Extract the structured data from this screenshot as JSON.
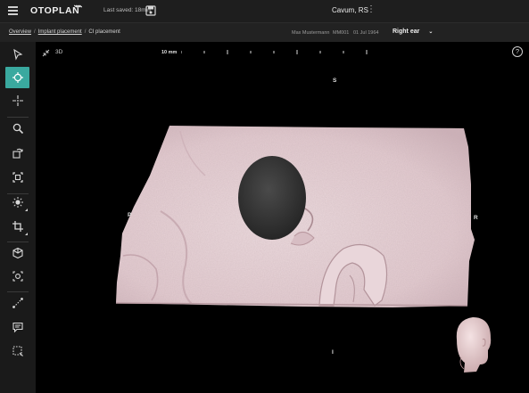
{
  "app": {
    "name": "OTOPLAN"
  },
  "header": {
    "last_saved": "Last saved: 18min",
    "patient_file": "Cavum, RS"
  },
  "breadcrumb": [
    "Overview",
    "Implant placement",
    "CI placement"
  ],
  "patient": {
    "name": "Max Mustermann",
    "id": "MM001",
    "dob": "01 Jul 1964",
    "side": "Right ear"
  },
  "toolbar": {
    "tools": [
      "select-arrow-icon",
      "crosshair-icon",
      "center-point-icon",
      "zoom-icon",
      "rotate-3d-icon",
      "fit-frame-icon",
      "brightness-icon",
      "crop-icon",
      "render-3d-icon",
      "focus-icon",
      "measure-icon",
      "comment-icon",
      "region-select-icon"
    ],
    "active_tool": "crosshair-icon"
  },
  "viewport": {
    "view_label": "3D",
    "scale_label": "10 mm",
    "orientation": {
      "top": "S",
      "left": "P",
      "right": "R",
      "bottom": "I"
    }
  },
  "colors": {
    "accent": "#3aa99f",
    "tissue": "#e8d3d7",
    "background": "#000000"
  }
}
